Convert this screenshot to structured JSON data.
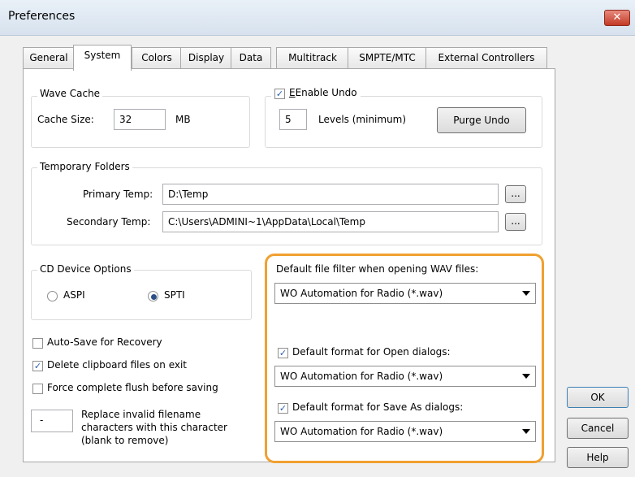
{
  "window": {
    "title": "Preferences",
    "close_glyph": "✕"
  },
  "tabs": [
    "General",
    "System",
    "Colors",
    "Display",
    "Data",
    "Multitrack",
    "SMPTE/MTC",
    "External Controllers"
  ],
  "wave_cache": {
    "group_label": "Wave Cache",
    "cache_label": "Cache Size:",
    "cache_value": "32",
    "unit": "MB"
  },
  "undo": {
    "enable_label": "Enable Undo",
    "enabled": true,
    "levels_value": "5",
    "levels_label": "Levels (minimum)",
    "purge_button": "Purge Undo"
  },
  "temp_folders": {
    "group_label": "Temporary Folders",
    "primary_label": "Primary Temp:",
    "primary_value": "D:\\Temp",
    "secondary_label": "Secondary Temp:",
    "secondary_value": "C:\\Users\\ADMINI~1\\AppData\\Local\\Temp",
    "browse_label": "..."
  },
  "cd_device": {
    "group_label": "CD Device Options",
    "option_aspi": "ASPI",
    "option_spti": "SPTI",
    "selected": "SPTI"
  },
  "checkboxes": [
    {
      "label": "Auto-Save for Recovery",
      "checked": false
    },
    {
      "label": "Delete clipboard files on exit",
      "checked": true
    },
    {
      "label": "Force complete flush before saving",
      "checked": false
    }
  ],
  "replace_char": {
    "value": "-",
    "line1": "Replace invalid filename",
    "line2": "characters with this character",
    "line3": "(blank to remove)"
  },
  "filters": {
    "wav_filter_label": "Default file filter when opening WAV files:",
    "wav_filter_value": "WO Automation for Radio (*.wav)",
    "open_label": "Default format for Open dialogs:",
    "open_checked": true,
    "open_value": "WO Automation for Radio (*.wav)",
    "saveas_label": "Default format for Save As dialogs:",
    "saveas_checked": true,
    "saveas_value": "WO Automation for Radio (*.wav)"
  },
  "buttons": {
    "ok": "OK",
    "cancel": "Cancel",
    "help": "Help"
  },
  "colors": {
    "highlight": "#f0a030",
    "titlebar": "#dde7f2",
    "close_button": "#c94a38"
  },
  "check_glyph": "✓"
}
